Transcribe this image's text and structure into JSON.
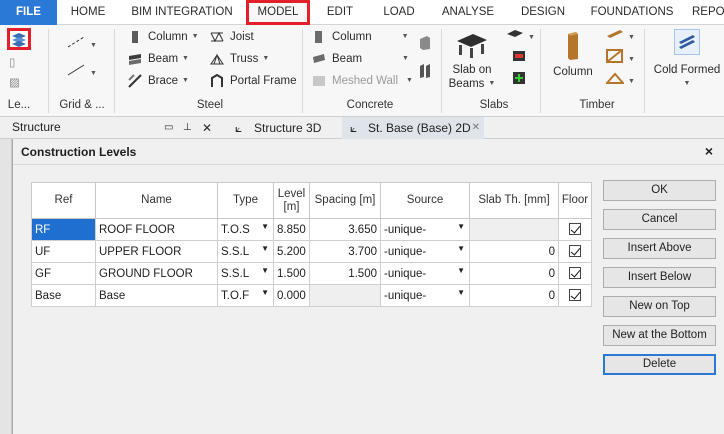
{
  "tabs": {
    "file": "FILE",
    "home": "HOME",
    "bim": "BIM INTEGRATION",
    "model": "MODEL",
    "edit": "EDIT",
    "load": "LOAD",
    "analyse": "ANALYSE",
    "design": "DESIGN",
    "foundations": "FOUNDATIONS",
    "more": "REPO"
  },
  "ribbon": {
    "levels_label": "Le...",
    "grid_label": "Grid & ...",
    "steel": {
      "label": "Steel",
      "column": "Column",
      "beam": "Beam",
      "brace": "Brace",
      "joist": "Joist",
      "truss": "Truss",
      "portal": "Portal Frame"
    },
    "concrete": {
      "label": "Concrete",
      "column": "Column",
      "beam": "Beam",
      "meshed_wall": "Meshed Wall"
    },
    "slabs": {
      "label": "Slabs",
      "slab_on_beams_1": "Slab on",
      "slab_on_beams_2": "Beams"
    },
    "timber": {
      "label": "Timber",
      "column": "Column"
    },
    "cold_formed": "Cold Formed"
  },
  "docs": {
    "panel_title": "Structure",
    "tab1": "Structure 3D",
    "tab2": "St. Base (Base) 2D"
  },
  "dialog": {
    "title": "Construction Levels",
    "close": "×",
    "columns": [
      "Ref",
      "Name",
      "Type",
      "Level [m]",
      "Spacing [m]",
      "Source",
      "Slab Th. [mm]",
      "Floor"
    ],
    "rows": [
      {
        "ref": "RF",
        "name": "ROOF FLOOR",
        "type": "T.O.S",
        "level": "8.850",
        "spacing": "3.650",
        "source": "-unique-",
        "slab": "",
        "floor": true
      },
      {
        "ref": "UF",
        "name": "UPPER FLOOR",
        "type": "S.S.L",
        "level": "5.200",
        "spacing": "3.700",
        "source": "-unique-",
        "slab": "0",
        "floor": true
      },
      {
        "ref": "GF",
        "name": "GROUND FLOOR",
        "type": "S.S.L",
        "level": "1.500",
        "spacing": "1.500",
        "source": "-unique-",
        "slab": "0",
        "floor": true
      },
      {
        "ref": "Base",
        "name": "Base",
        "type": "T.O.F",
        "level": "0.000",
        "spacing": "",
        "source": "-unique-",
        "slab": "0",
        "floor": true
      }
    ],
    "buttons": {
      "ok": "OK",
      "cancel": "Cancel",
      "insert_above": "Insert Above",
      "insert_below": "Insert Below",
      "new_on_top": "New on Top",
      "new_at_bottom": "New at the Bottom",
      "delete": "Delete"
    }
  },
  "colors": {
    "accent": "#2b79d6",
    "highlight": "#e3202a",
    "selection": "#1f6fd0"
  }
}
